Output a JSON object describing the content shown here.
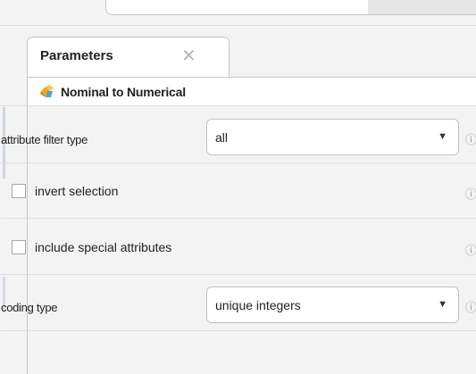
{
  "tab": {
    "label": "Parameters",
    "close_glyph": "✕"
  },
  "operator": {
    "title": "Nominal to Numerical",
    "icon": "operator-icon"
  },
  "params": {
    "attribute_filter_type": {
      "label": "attribute filter type",
      "value": "all"
    },
    "invert_selection": {
      "label": "invert selection",
      "checked": false
    },
    "include_special_attributes": {
      "label": "include special attributes",
      "checked": false
    },
    "coding_type": {
      "label": "coding type",
      "value": "unique integers"
    }
  },
  "icons": {
    "info": "ⓘ",
    "dropdown": "▼"
  },
  "colors": {
    "background": "#f3f3f3",
    "panel": "#ffffff",
    "border": "#c6c6c6",
    "icon_orange": "#f3a620",
    "icon_blue": "#4fa3d9"
  }
}
